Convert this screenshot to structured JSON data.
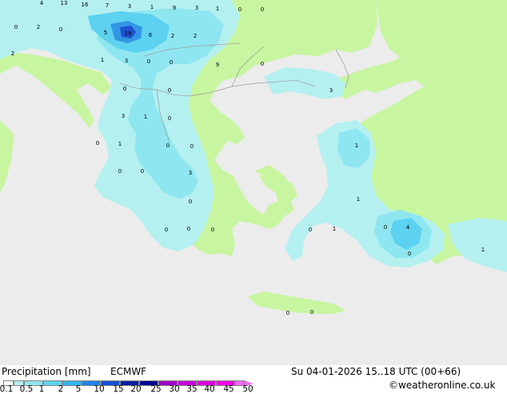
{
  "footer": {
    "title": "Precipitation [mm]",
    "model": "ECMWF",
    "valid_time": "Su 04-01-2026 15..18 UTC (00+66)",
    "credit": "©weatheronline.co.uk"
  },
  "legend": {
    "ticks": [
      "0.1",
      "0.5",
      "1",
      "2",
      "5",
      "10",
      "15",
      "20",
      "25",
      "30",
      "35",
      "40",
      "45",
      "50"
    ],
    "colors": [
      "#ffffff",
      "#b4f0f0",
      "#8ee6f0",
      "#5cd2f0",
      "#32b4f0",
      "#1e82e6",
      "#1450d2",
      "#0a1ea0",
      "#00008c",
      "#a000c8",
      "#c800dc",
      "#dc00dc",
      "#f000e6",
      "#ff64ff"
    ]
  },
  "map": {
    "colors": {
      "sea": "#ececec",
      "land": "#c8f5a0",
      "precip_light": "#b4f0f0",
      "precip_mid": "#8ee6f0",
      "precip_heavy": "#5cd2f0",
      "precip_strong": "#3296e6",
      "precip_core": "#1e50d2",
      "border": "#a0a0a0"
    },
    "values": [
      {
        "v": "4"
      },
      {
        "v": "13"
      },
      {
        "v": "16"
      },
      {
        "v": "7"
      },
      {
        "v": "3"
      },
      {
        "v": "1"
      },
      {
        "v": "9"
      },
      {
        "v": "3"
      },
      {
        "v": "1"
      },
      {
        "v": "0"
      },
      {
        "v": "0"
      },
      {
        "v": "0"
      },
      {
        "v": "2"
      },
      {
        "v": "0"
      },
      {
        "v": "5"
      },
      {
        "v": "19"
      },
      {
        "v": "6"
      },
      {
        "v": "2"
      },
      {
        "v": "2"
      },
      {
        "v": "2"
      },
      {
        "v": "1"
      },
      {
        "v": "3"
      },
      {
        "v": "0"
      },
      {
        "v": "0"
      },
      {
        "v": "9"
      },
      {
        "v": "0"
      },
      {
        "v": "0"
      },
      {
        "v": "0"
      },
      {
        "v": "3"
      },
      {
        "v": "3"
      },
      {
        "v": "1"
      },
      {
        "v": "0"
      },
      {
        "v": "0"
      },
      {
        "v": "1"
      },
      {
        "v": "0"
      },
      {
        "v": "0"
      },
      {
        "v": "1"
      },
      {
        "v": "0"
      },
      {
        "v": "0"
      },
      {
        "v": "3"
      },
      {
        "v": "1"
      },
      {
        "v": "0"
      },
      {
        "v": "0"
      },
      {
        "v": "0"
      },
      {
        "v": "0"
      },
      {
        "v": "1"
      },
      {
        "v": "0"
      },
      {
        "v": "4"
      },
      {
        "v": "0"
      },
      {
        "v": "0"
      },
      {
        "v": "1"
      },
      {
        "v": "0"
      },
      {
        "v": "0"
      }
    ]
  }
}
